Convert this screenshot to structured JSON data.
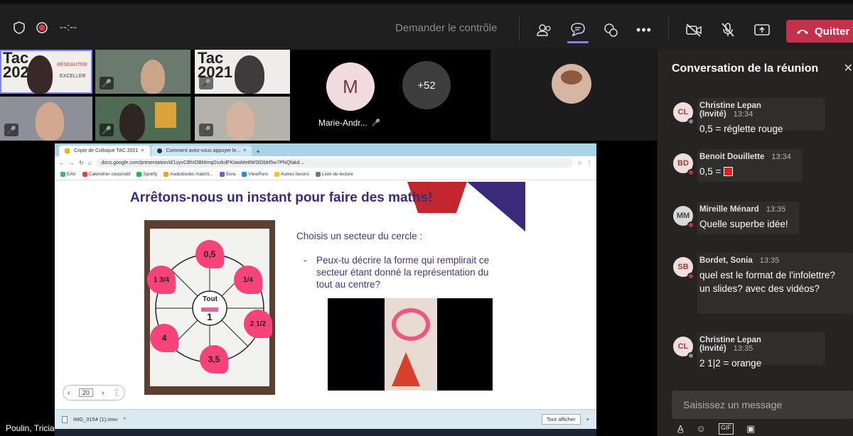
{
  "topbar": {
    "timer": "--:--",
    "request_control": "Demander le contrôle",
    "quit_label": "Quitter"
  },
  "participants": {
    "overflow_count": "+52",
    "featured": {
      "initial": "M",
      "name": "Marie-Andr..."
    },
    "tac_logo": "Tac 2021",
    "tac_tag1": "RÉSEAUTER",
    "tac_tag2": "EXCELLER"
  },
  "browser": {
    "tabs": [
      "Copie de Colloque TAC 2021",
      "Comment avez-vous appuyer le..."
    ],
    "url": "docs.google.com/presentation/d/1zyvCBhIOBMmqGvzkdFKtawMe8WSlDbM5w7PNQfakd...",
    "bookmarks": [
      "EAV",
      "Calendrier corporatif",
      "Spotify",
      "Audiobooks matchi...",
      "Sora",
      "ViewPure",
      "Autres favoris",
      "Liste de lecture"
    ],
    "download_file": "IMG_0154 (1).mov",
    "download_all": "Tout afficher"
  },
  "slide": {
    "title": "Arrêtons-nous un instant pour faire des maths!",
    "prompt": "Choisis un secteur du cercle :",
    "bullet": "Peux-tu décrire la forme qui remplirait ce secteur étant donné la représentation du tout au centre?",
    "center_label": "Tout",
    "center_value": "1",
    "hearts": [
      "0,5",
      "1 3/4",
      "1/4",
      "2 1/2",
      "4",
      "3,5"
    ],
    "page_number": "20"
  },
  "presenter_name": "Poulin, Tricia",
  "chat": {
    "title": "Conversation de la réunion",
    "messages": [
      {
        "initials": "CL",
        "author": "Christine Lepan (Invité)",
        "time": "13:34",
        "text": "0,5 = réglette rouge"
      },
      {
        "initials": "BD",
        "author": "Benoit Douillette",
        "time": "13:34",
        "text": "0,5 ="
      },
      {
        "initials": "MM",
        "author": "Mireille Ménard",
        "time": "13:35",
        "text": "Quelle superbe idée!"
      },
      {
        "initials": "SB",
        "author": "Bordet, Sonia",
        "time": "13:35",
        "text": "quel est le format de l'infolettre? un slides? avec des vidéos?"
      },
      {
        "initials": "CL",
        "author": "Christine Lepan (Invité)",
        "time": "13:35",
        "text": "2 1|2 = orange"
      }
    ],
    "compose_placeholder": "Saisissez un message"
  },
  "colors": {
    "accent": "#7f85f5",
    "quit": "#c4314b",
    "heart": "#f7437a",
    "slide_title": "#3a2a7a"
  }
}
